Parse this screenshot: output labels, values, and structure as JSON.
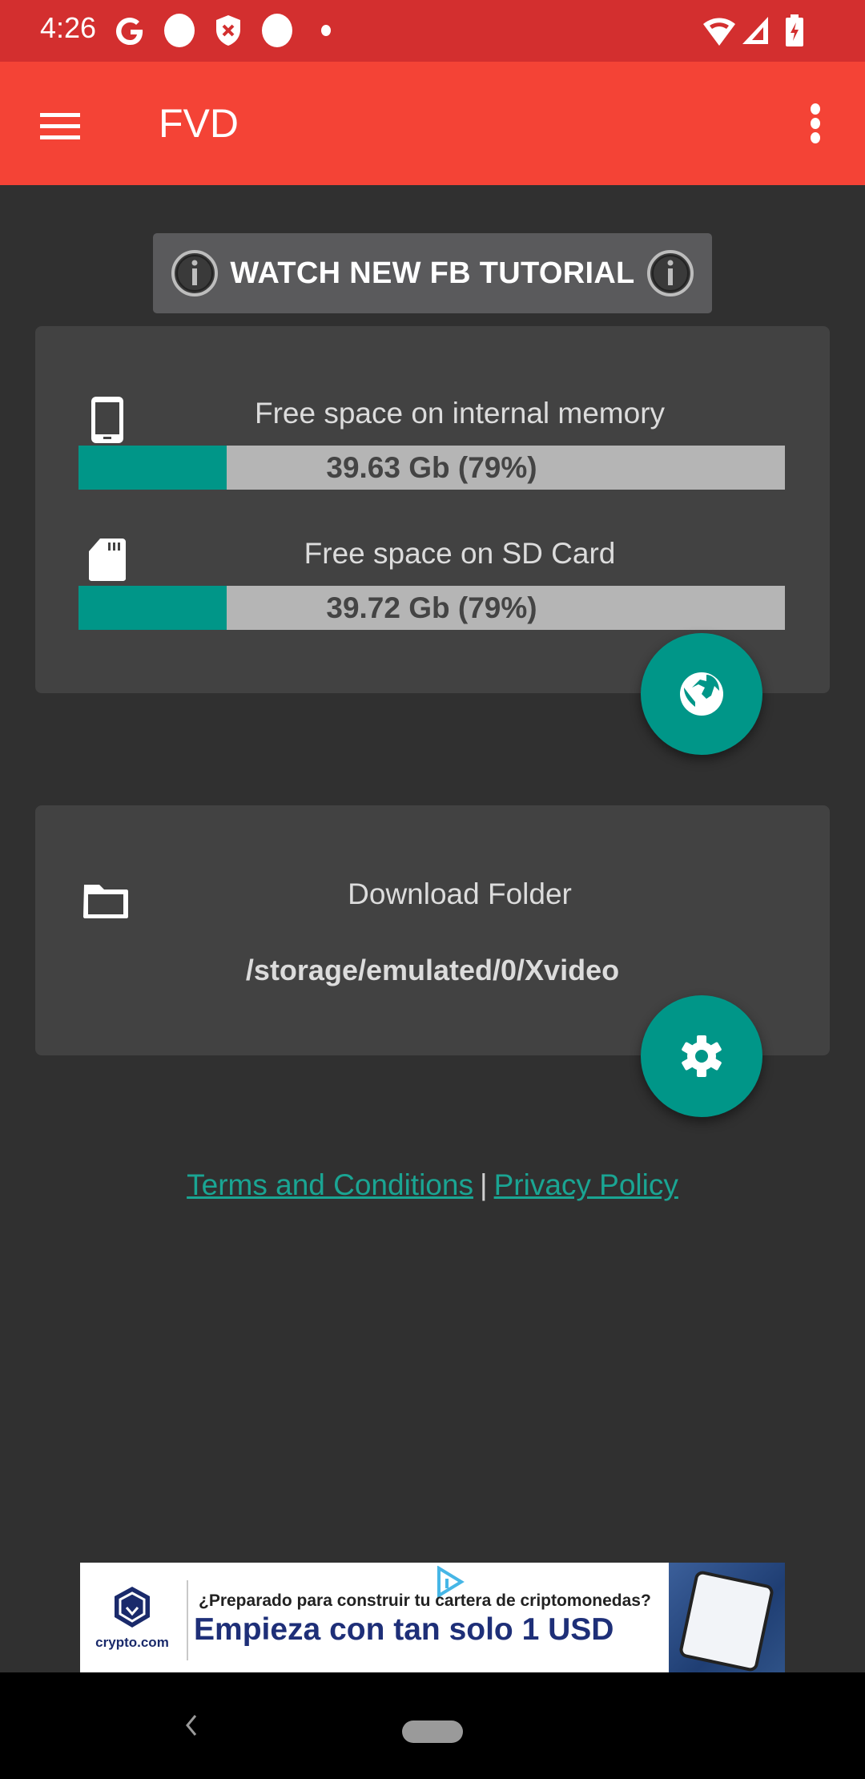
{
  "status_bar": {
    "time": "4:26",
    "left_icons": [
      "google-icon",
      "notification-dot-icon",
      "shield-x-icon",
      "notification-dot-icon",
      "small-dot-icon"
    ],
    "right_icons": [
      "wifi-icon",
      "cellular-signal-icon",
      "battery-charging-icon"
    ]
  },
  "app_bar": {
    "title": "FVD",
    "menu_icon": "hamburger-menu-icon",
    "overflow_icon": "more-vert-icon"
  },
  "tutorial_button": {
    "label": "WATCH NEW FB TUTORIAL",
    "icon": "info-icon"
  },
  "storage": {
    "internal": {
      "icon": "smartphone-icon",
      "label": "Free space on internal memory",
      "value_text": "39.63 Gb  (79%)",
      "used_fraction": 0.21
    },
    "sd_card": {
      "icon": "sd-card-icon",
      "label": "Free space on SD Card",
      "value_text": "39.72 Gb (79%)",
      "used_fraction": 0.21
    },
    "fab_icon": "globe-icon"
  },
  "download_folder": {
    "icon": "folder-icon",
    "label": "Download Folder",
    "path": "/storage/emulated/0/Xvideo",
    "fab_icon": "gear-icon"
  },
  "links": {
    "terms": "Terms and Conditions",
    "separator": "|",
    "privacy": "Privacy Policy"
  },
  "ad": {
    "brand": "crypto.com",
    "subtitle": "¿Preparado para construir tu cartera de criptomonedas?",
    "headline": "Empieza con tan solo 1 USD"
  },
  "colors": {
    "status_bar": "#d32f2f",
    "app_bar": "#f44336",
    "background": "#303030",
    "card": "#424242",
    "accent": "#009688",
    "bar_track": "#b5b5b5",
    "link": "#1aa593"
  }
}
